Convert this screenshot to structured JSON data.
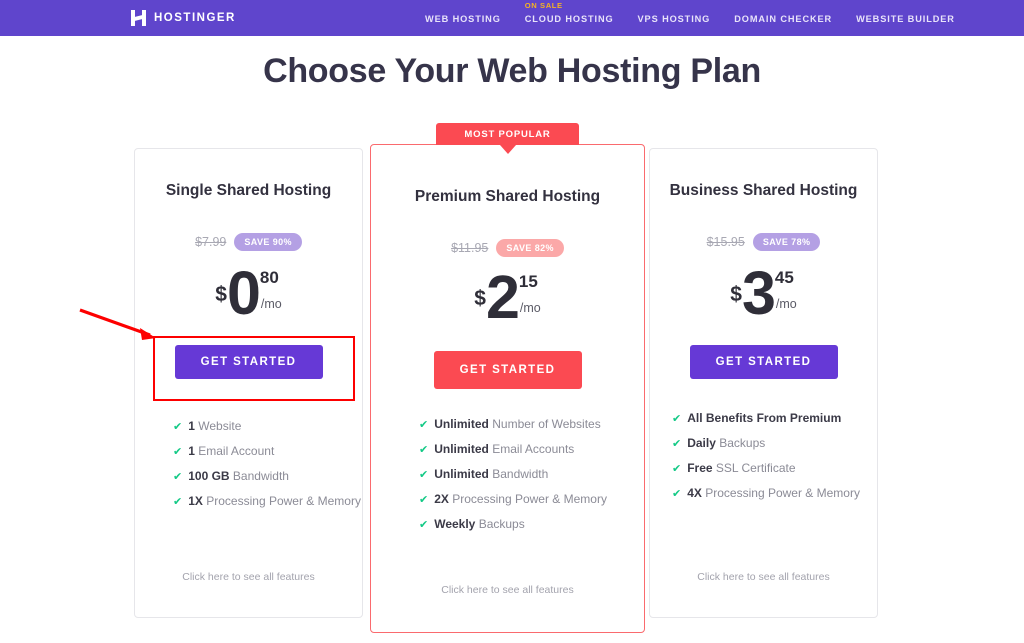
{
  "nav": {
    "brand": "HOSTINGER",
    "logo_icon": "hostinger-h-logo-icon",
    "items": [
      {
        "label": "WEB HOSTING",
        "badge": ""
      },
      {
        "label": "CLOUD HOSTING",
        "badge": "ON SALE"
      },
      {
        "label": "VPS HOSTING",
        "badge": ""
      },
      {
        "label": "DOMAIN CHECKER",
        "badge": ""
      },
      {
        "label": "WEBSITE BUILDER",
        "badge": ""
      }
    ],
    "bg_color": "#5f45cc",
    "badge_color": "#f5b222"
  },
  "header": {
    "title": "Choose Your Web Hosting Plan"
  },
  "featured_badge": {
    "label": "MOST POPULAR",
    "color": "#fb4a52"
  },
  "plans": [
    {
      "name": "Single Shared Hosting",
      "old_price": "$7.99",
      "save_label": "SAVE 90%",
      "save_color": "#b4a0e4",
      "currency": "$",
      "price_int": "0",
      "price_dec": "80",
      "period": "/mo",
      "cta": "GET STARTED",
      "cta_color": "#6639d6",
      "features": [
        {
          "bold": "1",
          "rest": "Website"
        },
        {
          "bold": "1",
          "rest": "Email Account"
        },
        {
          "bold": "100 GB",
          "rest": "Bandwidth"
        },
        {
          "bold": "1X",
          "rest": "Processing Power & Memory"
        }
      ],
      "see_all": "Click here to see all features"
    },
    {
      "name": "Premium Shared Hosting",
      "old_price": "$11.95",
      "save_label": "SAVE 82%",
      "save_color": "#fba8a8",
      "currency": "$",
      "price_int": "2",
      "price_dec": "15",
      "period": "/mo",
      "cta": "GET STARTED",
      "cta_color": "#fb4a52",
      "features": [
        {
          "bold": "Unlimited",
          "rest": "Number of Websites"
        },
        {
          "bold": "Unlimited",
          "rest": "Email Accounts"
        },
        {
          "bold": "Unlimited",
          "rest": "Bandwidth"
        },
        {
          "bold": "2X",
          "rest": "Processing Power & Memory"
        },
        {
          "bold": "Weekly",
          "rest": "Backups"
        }
      ],
      "see_all": "Click here to see all features"
    },
    {
      "name": "Business Shared Hosting",
      "old_price": "$15.95",
      "save_label": "SAVE 78%",
      "save_color": "#b4a0e4",
      "currency": "$",
      "price_int": "3",
      "price_dec": "45",
      "period": "/mo",
      "cta": "GET STARTED",
      "cta_color": "#6639d6",
      "features": [
        {
          "bold": "All Benefits From Premium",
          "rest": ""
        },
        {
          "bold": "Daily",
          "rest": "Backups"
        },
        {
          "bold": "Free",
          "rest": "SSL Certificate"
        },
        {
          "bold": "4X",
          "rest": "Processing Power & Memory"
        }
      ],
      "see_all": "Click here to see all features"
    }
  ],
  "annotations": {
    "highlight_color": "#fd0000",
    "target": "single-shared-hosting-get-started-button"
  }
}
